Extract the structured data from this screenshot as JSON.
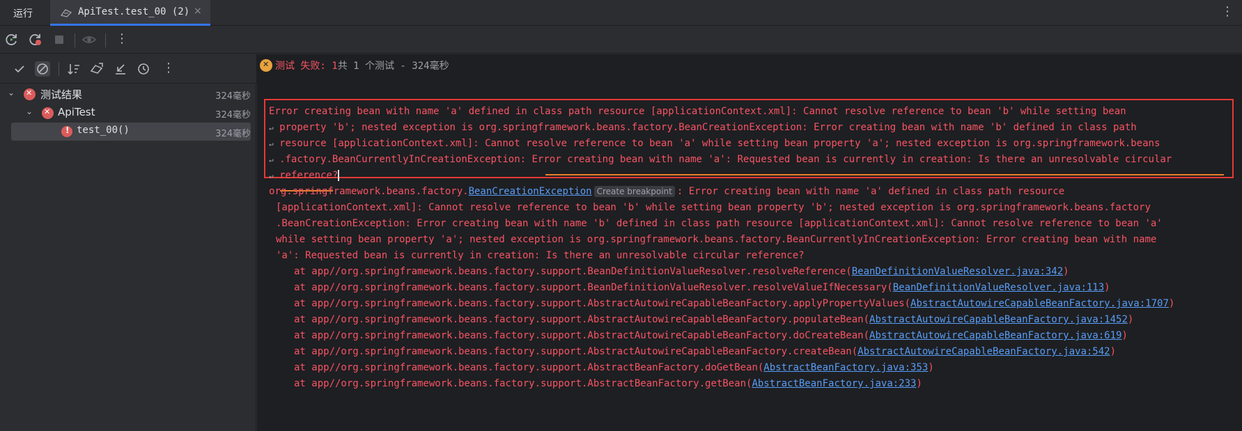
{
  "tabs": {
    "run_label": "运行",
    "active_label": "ApiTest.test_00 (2)",
    "close_glyph": "×"
  },
  "status": {
    "prefix": "测试 失败: 1",
    "suffix": "共 1 个测试 - 324毫秒"
  },
  "tree": {
    "items": [
      {
        "label": "测试结果",
        "duration": "324毫秒"
      },
      {
        "label": "ApiTest",
        "duration": "324毫秒"
      },
      {
        "label": "test_00()",
        "duration": "324毫秒"
      }
    ]
  },
  "console": {
    "msg": [
      "Error creating bean with name 'a' defined in class path resource [applicationContext.xml]: Cannot resolve reference to bean 'b' while setting bean",
      "property 'b'; nested exception is org.springframework.beans.factory.BeanCreationException: Error creating bean with name 'b' defined in class path",
      "resource [applicationContext.xml]: Cannot resolve reference to bean 'a' while setting bean property 'a'; nested exception is org.springframework.beans",
      ".factory.BeanCurrentlyInCreationException: Error creating bean with name 'a': Requested bean is currently in creation: Is there an unresolvable circular",
      "reference?"
    ],
    "exc_prefix": "org.springframework.beans.factory.",
    "exc_link": "BeanCreationException",
    "breakpoint_label": "Create breakpoint",
    "exc_rest": ": Error creating bean with name 'a' defined in class path resource",
    "exc_cont": [
      "[applicationContext.xml]: Cannot resolve reference to bean 'b' while setting bean property 'b'; nested exception is org.springframework.beans.factory",
      ".BeanCreationException: Error creating bean with name 'b' defined in class path resource [applicationContext.xml]: Cannot resolve reference to bean 'a'",
      "while setting bean property 'a'; nested exception is org.springframework.beans.factory.BeanCurrentlyInCreationException: Error creating bean with name",
      "'a': Requested bean is currently in creation: Is there an unresolvable circular reference?"
    ],
    "stack": [
      {
        "method": "at app//org.springframework.beans.factory.support.BeanDefinitionValueResolver.resolveReference(",
        "link": "BeanDefinitionValueResolver.java:342",
        "end": ")"
      },
      {
        "method": "at app//org.springframework.beans.factory.support.BeanDefinitionValueResolver.resolveValueIfNecessary(",
        "link": "BeanDefinitionValueResolver.java:113",
        "end": ")"
      },
      {
        "method": "at app//org.springframework.beans.factory.support.AbstractAutowireCapableBeanFactory.applyPropertyValues(",
        "link": "AbstractAutowireCapableBeanFactory.java:1707",
        "end": ")"
      },
      {
        "method": "at app//org.springframework.beans.factory.support.AbstractAutowireCapableBeanFactory.populateBean(",
        "link": "AbstractAutowireCapableBeanFactory.java:1452",
        "end": ")"
      },
      {
        "method": "at app//org.springframework.beans.factory.support.AbstractAutowireCapableBeanFactory.doCreateBean(",
        "link": "AbstractAutowireCapableBeanFactory.java:619",
        "end": ")"
      },
      {
        "method": "at app//org.springframework.beans.factory.support.AbstractAutowireCapableBeanFactory.createBean(",
        "link": "AbstractAutowireCapableBeanFactory.java:542",
        "end": ")"
      },
      {
        "method": "at app//org.springframework.beans.factory.support.AbstractBeanFactory.doGetBean(",
        "link": "AbstractBeanFactory.java:353",
        "end": ")"
      },
      {
        "method": "at app//org.springframework.beans.factory.support.AbstractBeanFactory.getBean(",
        "link": "AbstractBeanFactory.java:233",
        "end": ")"
      }
    ]
  },
  "colors": {
    "error_text": "#f75464",
    "link": "#589df6",
    "annotation_box": "#e53935",
    "annotation_underline": "#e8802a",
    "accent": "#3574f0"
  },
  "icons": {
    "tab": "junit-run-icon",
    "rerun": "rerun-icon",
    "rerun_failed": "rerun-failed-icon",
    "stop": "stop-icon",
    "preview": "eye-icon",
    "more": "more-vertical-icon"
  }
}
